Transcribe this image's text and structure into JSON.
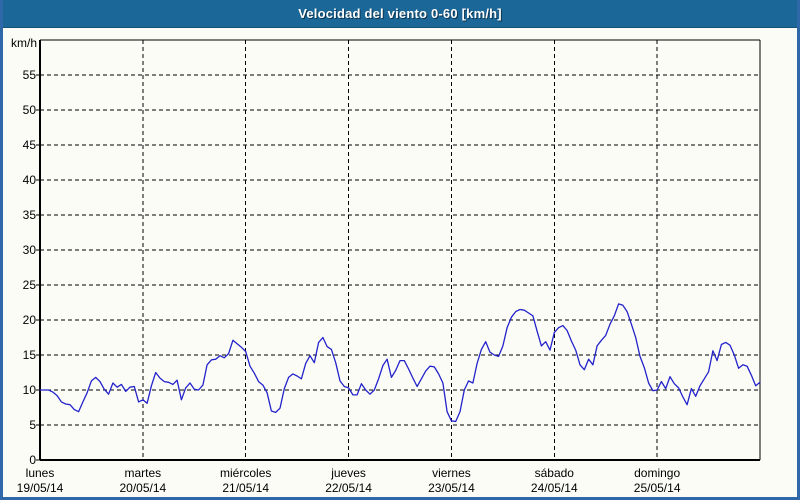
{
  "header": {
    "title": "Velocidad del viento 0-60 [km/h]"
  },
  "chart_data": {
    "type": "line",
    "title": "Velocidad del viento 0-60 [km/h]",
    "ylabel": "km/h",
    "xlabel": "",
    "ylim": [
      0,
      60
    ],
    "ytick_step": 5,
    "yticks": [
      0,
      5,
      10,
      15,
      20,
      25,
      30,
      35,
      40,
      45,
      50,
      55
    ],
    "grid": "dashed-black",
    "legend": "none",
    "sampling": "hourly, 24 points per day plus final endpoint",
    "x_axis": {
      "unit": "days",
      "categories": [
        {
          "day": "lunes",
          "date": "19/05/14"
        },
        {
          "day": "martes",
          "date": "20/05/14"
        },
        {
          "day": "miércoles",
          "date": "21/05/14"
        },
        {
          "day": "jueves",
          "date": "22/05/14"
        },
        {
          "day": "viernes",
          "date": "23/05/14"
        },
        {
          "day": "sábado",
          "date": "24/05/14"
        },
        {
          "day": "domingo",
          "date": "25/05/14"
        }
      ]
    },
    "series": [
      {
        "name": "Velocidad del viento [km/h]",
        "color": "#2323cb",
        "values": [
          10.0,
          10.0,
          10.0,
          9.7,
          9.2,
          8.3,
          8.0,
          7.9,
          7.2,
          6.9,
          8.3,
          9.6,
          11.3,
          11.8,
          11.2,
          10.1,
          9.4,
          11.0,
          10.4,
          10.8,
          9.8,
          10.4,
          10.5,
          8.3,
          8.6,
          8.1,
          10.6,
          12.5,
          11.7,
          11.2,
          11.1,
          10.8,
          11.4,
          8.6,
          10.3,
          11.0,
          10.1,
          10.0,
          10.7,
          13.6,
          14.3,
          14.4,
          14.9,
          14.6,
          15.2,
          17.1,
          16.6,
          16.1,
          15.5,
          13.4,
          12.4,
          11.2,
          10.7,
          9.6,
          7.0,
          6.8,
          7.4,
          10.2,
          11.8,
          12.3,
          12.0,
          11.6,
          13.8,
          14.9,
          13.9,
          16.8,
          17.5,
          16.2,
          15.8,
          13.9,
          11.3,
          10.5,
          10.3,
          9.3,
          9.3,
          10.9,
          10.0,
          9.4,
          10.0,
          11.6,
          13.5,
          14.4,
          11.8,
          12.8,
          14.2,
          14.2,
          13.0,
          11.7,
          10.5,
          11.6,
          12.7,
          13.4,
          13.3,
          12.3,
          11.0,
          6.9,
          5.6,
          5.5,
          6.9,
          10.0,
          11.3,
          11.0,
          13.8,
          15.8,
          16.9,
          15.4,
          15.0,
          14.8,
          16.3,
          18.9,
          20.4,
          21.2,
          21.5,
          21.4,
          21.0,
          20.6,
          18.4,
          16.3,
          16.9,
          15.7,
          18.2,
          18.9,
          19.2,
          18.5,
          17.0,
          15.7,
          13.6,
          12.9,
          14.4,
          13.6,
          16.3,
          17.1,
          17.8,
          19.4,
          20.6,
          22.3,
          22.1,
          21.2,
          19.4,
          17.5,
          14.8,
          13.2,
          11.0,
          9.9,
          10.0,
          11.2,
          10.2,
          11.9,
          10.9,
          10.3,
          9.0,
          7.9,
          10.2,
          9.1,
          10.6,
          11.6,
          12.6,
          15.6,
          14.2,
          16.5,
          16.8,
          16.4,
          15.0,
          13.1,
          13.6,
          13.4,
          12.1,
          10.6,
          11.1
        ]
      }
    ]
  },
  "colors": {
    "header_bg": "#1b6798",
    "window_border": "#2f68a9",
    "content_bg": "#fcfcf7",
    "grid": "#000000",
    "line": "#2323cb",
    "text": "#000000",
    "title_text": "#ffffff"
  }
}
